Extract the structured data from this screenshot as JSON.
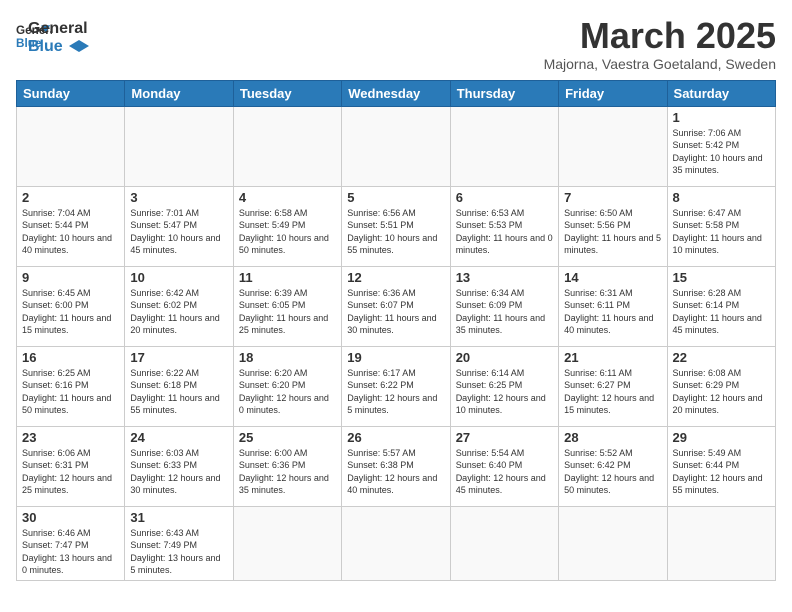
{
  "logo": {
    "text_general": "General",
    "text_blue": "Blue"
  },
  "header": {
    "title": "March 2025",
    "subtitle": "Majorna, Vaestra Goetaland, Sweden"
  },
  "weekdays": [
    "Sunday",
    "Monday",
    "Tuesday",
    "Wednesday",
    "Thursday",
    "Friday",
    "Saturday"
  ],
  "weeks": [
    [
      {
        "day": "",
        "info": ""
      },
      {
        "day": "",
        "info": ""
      },
      {
        "day": "",
        "info": ""
      },
      {
        "day": "",
        "info": ""
      },
      {
        "day": "",
        "info": ""
      },
      {
        "day": "",
        "info": ""
      },
      {
        "day": "1",
        "info": "Sunrise: 7:06 AM\nSunset: 5:42 PM\nDaylight: 10 hours\nand 35 minutes."
      }
    ],
    [
      {
        "day": "2",
        "info": "Sunrise: 7:04 AM\nSunset: 5:44 PM\nDaylight: 10 hours\nand 40 minutes."
      },
      {
        "day": "3",
        "info": "Sunrise: 7:01 AM\nSunset: 5:47 PM\nDaylight: 10 hours\nand 45 minutes."
      },
      {
        "day": "4",
        "info": "Sunrise: 6:58 AM\nSunset: 5:49 PM\nDaylight: 10 hours\nand 50 minutes."
      },
      {
        "day": "5",
        "info": "Sunrise: 6:56 AM\nSunset: 5:51 PM\nDaylight: 10 hours\nand 55 minutes."
      },
      {
        "day": "6",
        "info": "Sunrise: 6:53 AM\nSunset: 5:53 PM\nDaylight: 11 hours\nand 0 minutes."
      },
      {
        "day": "7",
        "info": "Sunrise: 6:50 AM\nSunset: 5:56 PM\nDaylight: 11 hours\nand 5 minutes."
      },
      {
        "day": "8",
        "info": "Sunrise: 6:47 AM\nSunset: 5:58 PM\nDaylight: 11 hours\nand 10 minutes."
      }
    ],
    [
      {
        "day": "9",
        "info": "Sunrise: 6:45 AM\nSunset: 6:00 PM\nDaylight: 11 hours\nand 15 minutes."
      },
      {
        "day": "10",
        "info": "Sunrise: 6:42 AM\nSunset: 6:02 PM\nDaylight: 11 hours\nand 20 minutes."
      },
      {
        "day": "11",
        "info": "Sunrise: 6:39 AM\nSunset: 6:05 PM\nDaylight: 11 hours\nand 25 minutes."
      },
      {
        "day": "12",
        "info": "Sunrise: 6:36 AM\nSunset: 6:07 PM\nDaylight: 11 hours\nand 30 minutes."
      },
      {
        "day": "13",
        "info": "Sunrise: 6:34 AM\nSunset: 6:09 PM\nDaylight: 11 hours\nand 35 minutes."
      },
      {
        "day": "14",
        "info": "Sunrise: 6:31 AM\nSunset: 6:11 PM\nDaylight: 11 hours\nand 40 minutes."
      },
      {
        "day": "15",
        "info": "Sunrise: 6:28 AM\nSunset: 6:14 PM\nDaylight: 11 hours\nand 45 minutes."
      }
    ],
    [
      {
        "day": "16",
        "info": "Sunrise: 6:25 AM\nSunset: 6:16 PM\nDaylight: 11 hours\nand 50 minutes."
      },
      {
        "day": "17",
        "info": "Sunrise: 6:22 AM\nSunset: 6:18 PM\nDaylight: 11 hours\nand 55 minutes."
      },
      {
        "day": "18",
        "info": "Sunrise: 6:20 AM\nSunset: 6:20 PM\nDaylight: 12 hours\nand 0 minutes."
      },
      {
        "day": "19",
        "info": "Sunrise: 6:17 AM\nSunset: 6:22 PM\nDaylight: 12 hours\nand 5 minutes."
      },
      {
        "day": "20",
        "info": "Sunrise: 6:14 AM\nSunset: 6:25 PM\nDaylight: 12 hours\nand 10 minutes."
      },
      {
        "day": "21",
        "info": "Sunrise: 6:11 AM\nSunset: 6:27 PM\nDaylight: 12 hours\nand 15 minutes."
      },
      {
        "day": "22",
        "info": "Sunrise: 6:08 AM\nSunset: 6:29 PM\nDaylight: 12 hours\nand 20 minutes."
      }
    ],
    [
      {
        "day": "23",
        "info": "Sunrise: 6:06 AM\nSunset: 6:31 PM\nDaylight: 12 hours\nand 25 minutes."
      },
      {
        "day": "24",
        "info": "Sunrise: 6:03 AM\nSunset: 6:33 PM\nDaylight: 12 hours\nand 30 minutes."
      },
      {
        "day": "25",
        "info": "Sunrise: 6:00 AM\nSunset: 6:36 PM\nDaylight: 12 hours\nand 35 minutes."
      },
      {
        "day": "26",
        "info": "Sunrise: 5:57 AM\nSunset: 6:38 PM\nDaylight: 12 hours\nand 40 minutes."
      },
      {
        "day": "27",
        "info": "Sunrise: 5:54 AM\nSunset: 6:40 PM\nDaylight: 12 hours\nand 45 minutes."
      },
      {
        "day": "28",
        "info": "Sunrise: 5:52 AM\nSunset: 6:42 PM\nDaylight: 12 hours\nand 50 minutes."
      },
      {
        "day": "29",
        "info": "Sunrise: 5:49 AM\nSunset: 6:44 PM\nDaylight: 12 hours\nand 55 minutes."
      }
    ],
    [
      {
        "day": "30",
        "info": "Sunrise: 6:46 AM\nSunset: 7:47 PM\nDaylight: 13 hours\nand 0 minutes."
      },
      {
        "day": "31",
        "info": "Sunrise: 6:43 AM\nSunset: 7:49 PM\nDaylight: 13 hours\nand 5 minutes."
      },
      {
        "day": "",
        "info": ""
      },
      {
        "day": "",
        "info": ""
      },
      {
        "day": "",
        "info": ""
      },
      {
        "day": "",
        "info": ""
      },
      {
        "day": "",
        "info": ""
      }
    ]
  ]
}
